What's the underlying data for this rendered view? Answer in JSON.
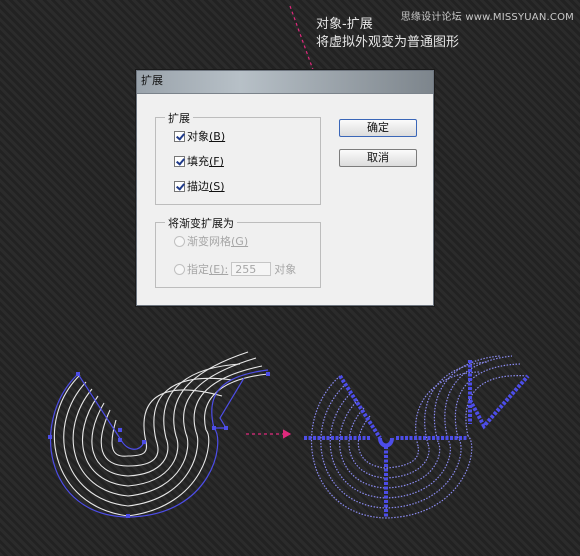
{
  "watermark": "思缘设计论坛 www.MISSYUAN.COM",
  "annotation": {
    "line1": "对象-扩展",
    "line2": "将虚拟外观变为普通图形"
  },
  "dialog": {
    "title": "扩展",
    "expand_group": {
      "label": "扩展",
      "options": [
        {
          "text": "对象",
          "mnemonic": "(B)",
          "checked": true
        },
        {
          "text": "填充",
          "mnemonic": "(F)",
          "checked": true
        },
        {
          "text": "描边",
          "mnemonic": "(S)",
          "checked": true
        }
      ]
    },
    "gradient_group": {
      "label": "将渐变扩展为",
      "options": [
        {
          "text": "渐变网格",
          "mnemonic": "(G)",
          "enabled": false
        },
        {
          "text": "指定",
          "mnemonic": "(E):",
          "enabled": false
        }
      ],
      "specify_value": "255",
      "specify_unit": "对象"
    },
    "ok_label": "确定",
    "cancel_label": "取消"
  },
  "colors": {
    "accent_pink": "#e0297d",
    "path_blue": "#4d4de8",
    "stripe_white": "#e8e8e8"
  }
}
